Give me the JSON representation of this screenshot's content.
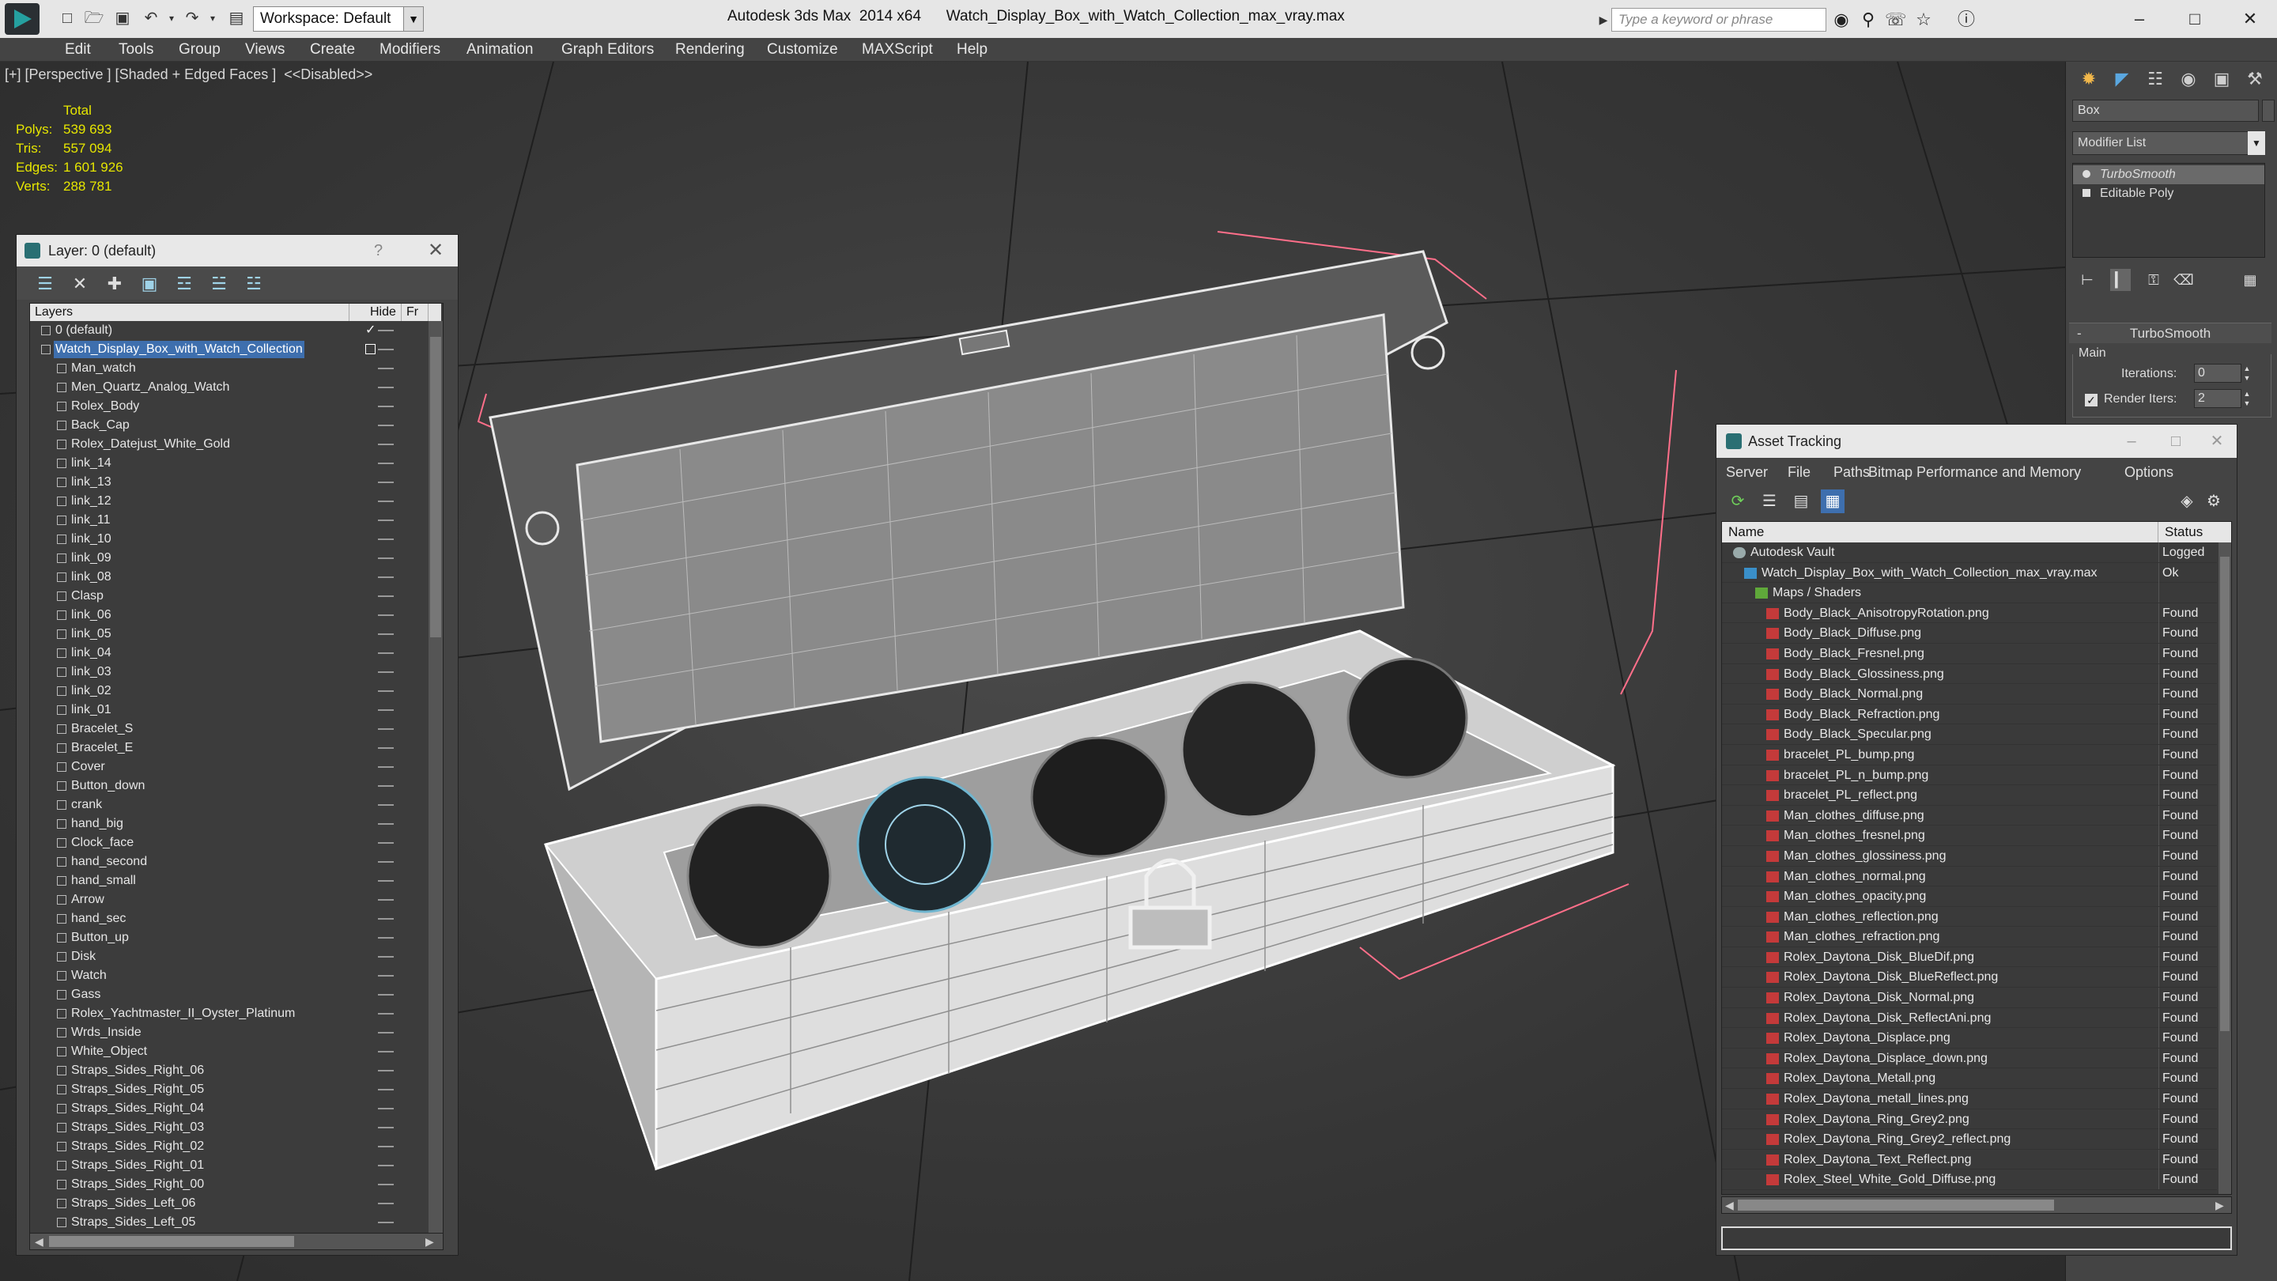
{
  "titlebar": {
    "workspace": "Workspace: Default",
    "app": "Autodesk 3ds Max  2014 x64",
    "file": "Watch_Display_Box_with_Watch_Collection_max_vray.max",
    "search_placeholder": "Type a keyword or phrase"
  },
  "menu": [
    "Edit",
    "Tools",
    "Group",
    "Views",
    "Create",
    "Modifiers",
    "Animation",
    "Graph Editors",
    "Rendering",
    "Customize",
    "MAXScript",
    "Help"
  ],
  "viewport": {
    "label": "[+] [Perspective ] [Shaded + Edged Faces ]  <<Disabled>>",
    "stats": {
      "header": "Total",
      "rows": [
        {
          "label": "Polys:",
          "value": "539 693"
        },
        {
          "label": "Tris:",
          "value": "557 094"
        },
        {
          "label": "Edges:",
          "value": "1 601 926"
        },
        {
          "label": "Verts:",
          "value": "288 781"
        }
      ]
    }
  },
  "layer_panel": {
    "title": "Layer: 0 (default)",
    "help": "?",
    "columns": [
      "Layers",
      "Hide",
      "Fr"
    ],
    "rows": [
      {
        "name": "0 (default)",
        "level": 1,
        "check": true
      },
      {
        "name": "Watch_Display_Box_with_Watch_Collection",
        "level": 1,
        "selected": true
      },
      {
        "name": "Man_watch",
        "level": 2
      },
      {
        "name": "Men_Quartz_Analog_Watch",
        "level": 2
      },
      {
        "name": "Rolex_Body",
        "level": 2
      },
      {
        "name": "Back_Cap",
        "level": 2
      },
      {
        "name": "Rolex_Datejust_White_Gold",
        "level": 2
      },
      {
        "name": "link_14",
        "level": 2
      },
      {
        "name": "link_13",
        "level": 2
      },
      {
        "name": "link_12",
        "level": 2
      },
      {
        "name": "link_11",
        "level": 2
      },
      {
        "name": "link_10",
        "level": 2
      },
      {
        "name": "link_09",
        "level": 2
      },
      {
        "name": "link_08",
        "level": 2
      },
      {
        "name": "Clasp",
        "level": 2
      },
      {
        "name": "link_06",
        "level": 2
      },
      {
        "name": "link_05",
        "level": 2
      },
      {
        "name": "link_04",
        "level": 2
      },
      {
        "name": "link_03",
        "level": 2
      },
      {
        "name": "link_02",
        "level": 2
      },
      {
        "name": "link_01",
        "level": 2
      },
      {
        "name": "Bracelet_S",
        "level": 2
      },
      {
        "name": "Bracelet_E",
        "level": 2
      },
      {
        "name": "Cover",
        "level": 2
      },
      {
        "name": "Button_down",
        "level": 2
      },
      {
        "name": "crank",
        "level": 2
      },
      {
        "name": "hand_big",
        "level": 2
      },
      {
        "name": "Clock_face",
        "level": 2
      },
      {
        "name": "hand_second",
        "level": 2
      },
      {
        "name": "hand_small",
        "level": 2
      },
      {
        "name": "Arrow",
        "level": 2
      },
      {
        "name": "hand_sec",
        "level": 2
      },
      {
        "name": "Button_up",
        "level": 2
      },
      {
        "name": "Disk",
        "level": 2
      },
      {
        "name": "Watch",
        "level": 2
      },
      {
        "name": "Gass",
        "level": 2
      },
      {
        "name": "Rolex_Yachtmaster_II_Oyster_Platinum",
        "level": 2
      },
      {
        "name": "Wrds_Inside",
        "level": 2
      },
      {
        "name": "White_Object",
        "level": 2
      },
      {
        "name": "Straps_Sides_Right_06",
        "level": 2
      },
      {
        "name": "Straps_Sides_Right_05",
        "level": 2
      },
      {
        "name": "Straps_Sides_Right_04",
        "level": 2
      },
      {
        "name": "Straps_Sides_Right_03",
        "level": 2
      },
      {
        "name": "Straps_Sides_Right_02",
        "level": 2
      },
      {
        "name": "Straps_Sides_Right_01",
        "level": 2
      },
      {
        "name": "Straps_Sides_Right_00",
        "level": 2
      },
      {
        "name": "Straps_Sides_Left_06",
        "level": 2
      },
      {
        "name": "Straps_Sides_Left_05",
        "level": 2
      }
    ]
  },
  "command_panel": {
    "object_name": "Box",
    "modifier_list": "Modifier List",
    "stack": [
      "TurboSmooth",
      "Editable Poly"
    ],
    "rollout_title": "TurboSmooth",
    "group_main": "Main",
    "iterations_label": "Iterations:",
    "iterations_value": "0",
    "render_iters_label": "Render Iters:",
    "render_iters_value": "2"
  },
  "asset_tracking": {
    "title": "Asset Tracking",
    "menu": [
      "Server",
      "File",
      "Paths",
      "Bitmap Performance and Memory",
      "Options"
    ],
    "columns": [
      "Name",
      "Status"
    ],
    "rows": [
      {
        "name": "Autodesk Vault",
        "status": "Logged",
        "level": 0,
        "icon": "vault"
      },
      {
        "name": "Watch_Display_Box_with_Watch_Collection_max_vray.max",
        "status": "Ok",
        "level": 1,
        "icon": "max"
      },
      {
        "name": "Maps / Shaders",
        "status": "",
        "level": 2,
        "icon": "folder"
      },
      {
        "name": "Body_Black_AnisotropyRotation.png",
        "status": "Found",
        "level": 3,
        "icon": "png"
      },
      {
        "name": "Body_Black_Diffuse.png",
        "status": "Found",
        "level": 3,
        "icon": "png"
      },
      {
        "name": "Body_Black_Fresnel.png",
        "status": "Found",
        "level": 3,
        "icon": "png"
      },
      {
        "name": "Body_Black_Glossiness.png",
        "status": "Found",
        "level": 3,
        "icon": "png"
      },
      {
        "name": "Body_Black_Normal.png",
        "status": "Found",
        "level": 3,
        "icon": "png"
      },
      {
        "name": "Body_Black_Refraction.png",
        "status": "Found",
        "level": 3,
        "icon": "png"
      },
      {
        "name": "Body_Black_Specular.png",
        "status": "Found",
        "level": 3,
        "icon": "png"
      },
      {
        "name": "bracelet_PL_bump.png",
        "status": "Found",
        "level": 3,
        "icon": "png"
      },
      {
        "name": "bracelet_PL_n_bump.png",
        "status": "Found",
        "level": 3,
        "icon": "png"
      },
      {
        "name": "bracelet_PL_reflect.png",
        "status": "Found",
        "level": 3,
        "icon": "png"
      },
      {
        "name": "Man_clothes_diffuse.png",
        "status": "Found",
        "level": 3,
        "icon": "png"
      },
      {
        "name": "Man_clothes_fresnel.png",
        "status": "Found",
        "level": 3,
        "icon": "png"
      },
      {
        "name": "Man_clothes_glossiness.png",
        "status": "Found",
        "level": 3,
        "icon": "png"
      },
      {
        "name": "Man_clothes_normal.png",
        "status": "Found",
        "level": 3,
        "icon": "png"
      },
      {
        "name": "Man_clothes_opacity.png",
        "status": "Found",
        "level": 3,
        "icon": "png"
      },
      {
        "name": "Man_clothes_reflection.png",
        "status": "Found",
        "level": 3,
        "icon": "png"
      },
      {
        "name": "Man_clothes_refraction.png",
        "status": "Found",
        "level": 3,
        "icon": "png"
      },
      {
        "name": "Rolex_Daytona_Disk_BlueDif.png",
        "status": "Found",
        "level": 3,
        "icon": "png"
      },
      {
        "name": "Rolex_Daytona_Disk_BlueReflect.png",
        "status": "Found",
        "level": 3,
        "icon": "png"
      },
      {
        "name": "Rolex_Daytona_Disk_Normal.png",
        "status": "Found",
        "level": 3,
        "icon": "png"
      },
      {
        "name": "Rolex_Daytona_Disk_ReflectAni.png",
        "status": "Found",
        "level": 3,
        "icon": "png"
      },
      {
        "name": "Rolex_Daytona_Displace.png",
        "status": "Found",
        "level": 3,
        "icon": "png"
      },
      {
        "name": "Rolex_Daytona_Displace_down.png",
        "status": "Found",
        "level": 3,
        "icon": "png"
      },
      {
        "name": "Rolex_Daytona_Metall.png",
        "status": "Found",
        "level": 3,
        "icon": "png"
      },
      {
        "name": "Rolex_Daytona_metall_lines.png",
        "status": "Found",
        "level": 3,
        "icon": "png"
      },
      {
        "name": "Rolex_Daytona_Ring_Grey2.png",
        "status": "Found",
        "level": 3,
        "icon": "png"
      },
      {
        "name": "Rolex_Daytona_Ring_Grey2_reflect.png",
        "status": "Found",
        "level": 3,
        "icon": "png"
      },
      {
        "name": "Rolex_Daytona_Text_Reflect.png",
        "status": "Found",
        "level": 3,
        "icon": "png"
      },
      {
        "name": "Rolex_Steel_White_Gold_Diffuse.png",
        "status": "Found",
        "level": 3,
        "icon": "png"
      }
    ]
  },
  "colors": {
    "stats_text": "#e6e600",
    "selection": "#3e6fae",
    "selection_bracket": "#ff6f8a",
    "wire": "#e8e8e8"
  }
}
